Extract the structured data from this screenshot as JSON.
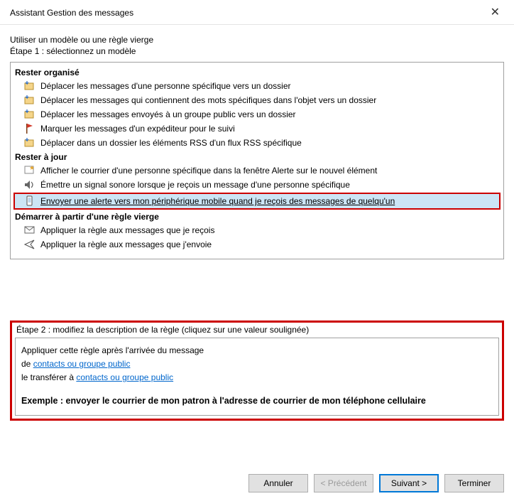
{
  "title": "Assistant Gestion des messages",
  "intro": {
    "line1": "Utiliser un modèle ou une règle vierge",
    "line2": "Étape 1 : sélectionnez un modèle"
  },
  "sections": {
    "organised": {
      "header": "Rester organisé",
      "items": [
        {
          "label": "Déplacer les messages d'une personne spécifique vers un dossier",
          "icon": "move-folder"
        },
        {
          "label": "Déplacer les messages qui contiennent des mots spécifiques dans l'objet vers un dossier",
          "icon": "move-folder"
        },
        {
          "label": "Déplacer les messages envoyés à un groupe public vers un dossier",
          "icon": "move-folder"
        },
        {
          "label": "Marquer les messages d'un expéditeur pour le suivi",
          "icon": "flag"
        },
        {
          "label": "Déplacer dans un dossier les éléments RSS d'un flux RSS spécifique",
          "icon": "move-folder"
        }
      ]
    },
    "uptodate": {
      "header": "Rester à jour",
      "items": [
        {
          "label": "Afficher le courrier d'une personne spécifique dans la fenêtre Alerte sur le nouvel élément",
          "icon": "alert-star"
        },
        {
          "label": "Émettre un signal sonore lorsque je reçois un message d'une personne spécifique",
          "icon": "sound"
        },
        {
          "label": "Envoyer une alerte vers mon périphérique mobile quand je reçois des messages de quelqu'un",
          "icon": "mobile",
          "selected": true
        }
      ]
    },
    "blank": {
      "header": "Démarrer à partir d'une règle vierge",
      "items": [
        {
          "label": "Appliquer la règle aux messages que je reçois",
          "icon": "envelope"
        },
        {
          "label": "Appliquer la règle aux messages que j'envoie",
          "icon": "send"
        }
      ]
    }
  },
  "step2": {
    "label": "Étape 2 : modifiez la description de la règle (cliquez sur une valeur soulignée)",
    "line1": "Appliquer cette règle après l'arrivée du message",
    "line2_prefix": "de ",
    "line2_link": "contacts ou groupe public",
    "line3_prefix": "le transférer à ",
    "line3_link": "contacts ou groupe public",
    "example": "Exemple : envoyer le courrier de mon patron à l'adresse de courrier de mon téléphone cellulaire"
  },
  "buttons": {
    "cancel": "Annuler",
    "prev": "< Précédent",
    "next": "Suivant >",
    "finish": "Terminer"
  }
}
